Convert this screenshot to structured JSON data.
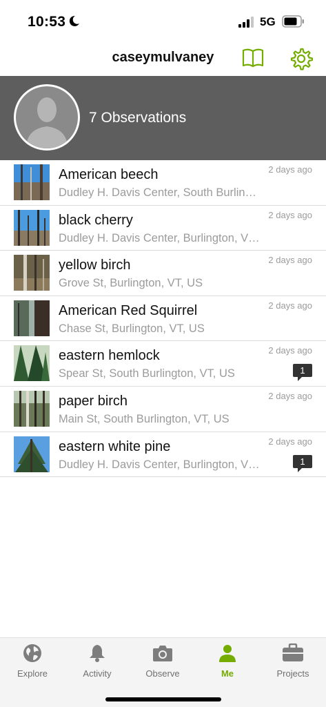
{
  "status_bar": {
    "time": "10:53",
    "network": "5G"
  },
  "header": {
    "username": "caseymulvaney"
  },
  "profile": {
    "observations_label": "7 Observations"
  },
  "accent_color": "#74ac00",
  "observations": [
    {
      "name": "American beech",
      "place": "Dudley H. Davis Center, South Burlington, VT, US",
      "date": "2 days ago",
      "comments": ""
    },
    {
      "name": "black cherry",
      "place": "Dudley H. Davis Center, Burlington, VT, US",
      "date": "2 days ago",
      "comments": ""
    },
    {
      "name": "yellow birch",
      "place": "Grove St, Burlington, VT, US",
      "date": "2 days ago",
      "comments": ""
    },
    {
      "name": "American Red Squirrel",
      "place": "Chase St, Burlington, VT, US",
      "date": "2 days ago",
      "comments": ""
    },
    {
      "name": "eastern hemlock",
      "place": "Spear St, South Burlington, VT, US",
      "date": "2 days ago",
      "comments": "1"
    },
    {
      "name": "paper birch",
      "place": "Main St, South Burlington, VT, US",
      "date": "2 days ago",
      "comments": ""
    },
    {
      "name": "eastern white pine",
      "place": "Dudley H. Davis Center, Burlington, VT, US",
      "date": "2 days ago",
      "comments": "1"
    }
  ],
  "tabs": [
    {
      "label": "Explore",
      "icon": "globe-icon"
    },
    {
      "label": "Activity",
      "icon": "bell-icon"
    },
    {
      "label": "Observe",
      "icon": "camera-icon"
    },
    {
      "label": "Me",
      "icon": "person-icon",
      "active": true
    },
    {
      "label": "Projects",
      "icon": "briefcase-icon"
    }
  ]
}
